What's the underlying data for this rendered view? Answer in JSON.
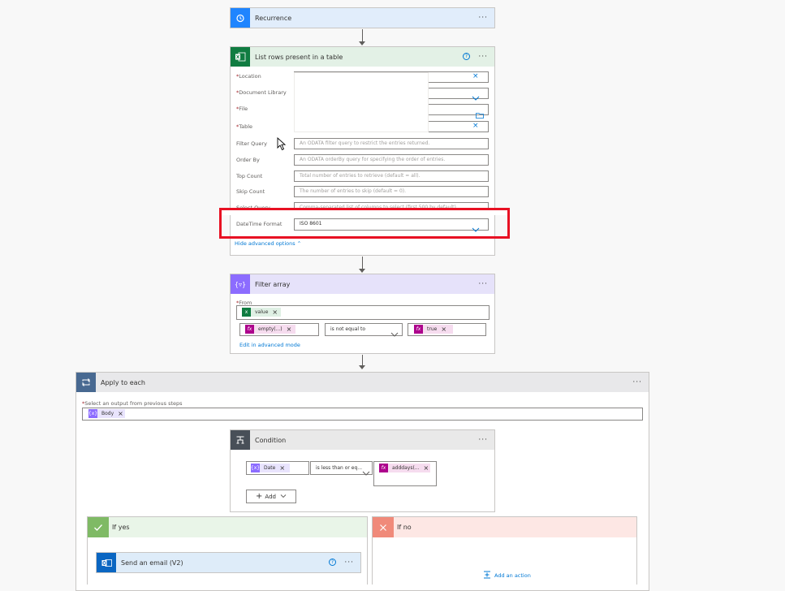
{
  "recurrence": {
    "title": "Recurrence",
    "more": "···"
  },
  "list_rows": {
    "title": "List rows present in a table",
    "help": "?",
    "more": "···",
    "fields": {
      "location": {
        "label": "Location"
      },
      "document_library": {
        "label": "Document Library"
      },
      "file": {
        "label": "File"
      },
      "table": {
        "label": "Table"
      },
      "filter_query": {
        "label": "Filter Query",
        "placeholder": "An ODATA filter query to restrict the entries returned."
      },
      "order_by": {
        "label": "Order By",
        "placeholder": "An ODATA orderBy query for specifying the order of entries."
      },
      "top_count": {
        "label": "Top Count",
        "placeholder": "Total number of entries to retrieve (default = all)."
      },
      "skip_count": {
        "label": "Skip Count",
        "placeholder": "The number of entries to skip (default = 0)."
      },
      "select_query": {
        "label": "Select Query",
        "placeholder": "Comma-separated list of columns to select (first 500 by default)."
      },
      "datetime_format": {
        "label": "DateTime Format",
        "value": "ISO 8601"
      }
    },
    "hide_advanced": "Hide advanced options"
  },
  "filter_array": {
    "title": "Filter array",
    "more": "···",
    "from_label": "From",
    "from_token": "value",
    "left_token": "empty(...)",
    "operator": "is not equal to",
    "right_token": "true",
    "edit_advanced": "Edit in advanced mode"
  },
  "apply_each": {
    "title": "Apply to each",
    "more": "···",
    "select_label": "Select an output from previous steps",
    "token": "Body"
  },
  "condition": {
    "title": "Condition",
    "more": "···",
    "left_token": "Date",
    "operator": "is less than or eq...",
    "right_token": "adddays(...",
    "add_label": "Add"
  },
  "if_yes": {
    "title": "If yes",
    "send_email": "Send an email (V2)",
    "help": "?",
    "more": "···"
  },
  "if_no": {
    "title": "If no",
    "add_action": "Add an action"
  },
  "colors": {
    "highlight": "#e81123",
    "link": "#0078d4",
    "excel": "#107c41",
    "expression": "#ad008c",
    "variable": "#7b64ff"
  }
}
